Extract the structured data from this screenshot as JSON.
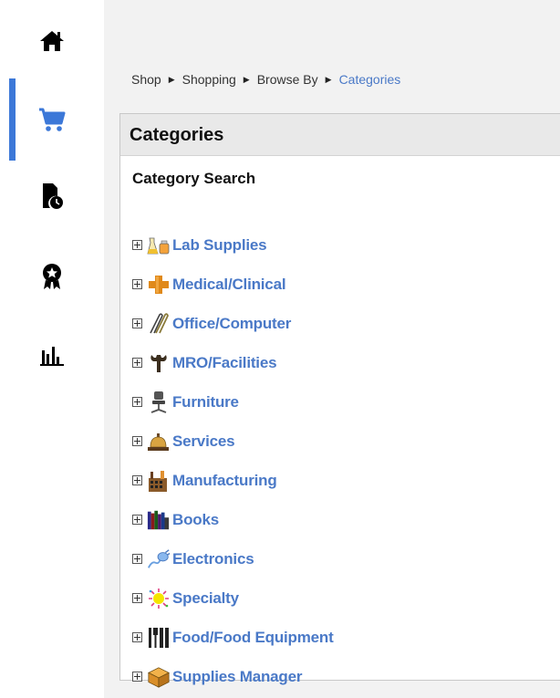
{
  "nav": {
    "items": [
      {
        "icon": "home-icon"
      },
      {
        "icon": "cart-icon",
        "active": true
      },
      {
        "icon": "order-history-icon"
      },
      {
        "icon": "award-icon"
      },
      {
        "icon": "bar-chart-icon"
      }
    ],
    "accent": "#3c78d8"
  },
  "breadcrumb": {
    "items": [
      "Shop",
      "Shopping",
      "Browse By"
    ],
    "current": "Categories",
    "separator": "▶"
  },
  "panel": {
    "title": "Categories",
    "subheading": "Category Search"
  },
  "categories": [
    {
      "label": "Lab Supplies",
      "icon": "lab-flask-icon"
    },
    {
      "label": "Medical/Clinical",
      "icon": "medical-cross-icon"
    },
    {
      "label": "Office/Computer",
      "icon": "paperclip-icon"
    },
    {
      "label": "MRO/Facilities",
      "icon": "wrench-icon"
    },
    {
      "label": "Furniture",
      "icon": "office-chair-icon"
    },
    {
      "label": "Services",
      "icon": "service-bell-icon"
    },
    {
      "label": "Manufacturing",
      "icon": "factory-icon"
    },
    {
      "label": "Books",
      "icon": "books-icon"
    },
    {
      "label": "Electronics",
      "icon": "electronics-plug-icon"
    },
    {
      "label": "Specialty",
      "icon": "sparkle-icon"
    },
    {
      "label": "Food/Food Equipment",
      "icon": "utensils-icon"
    },
    {
      "label": "Supplies Manager",
      "icon": "box-icon"
    }
  ],
  "colors": {
    "link": "#4a79c7",
    "main_bg": "#f2f2f2",
    "header_bg": "#e9e9e9"
  }
}
